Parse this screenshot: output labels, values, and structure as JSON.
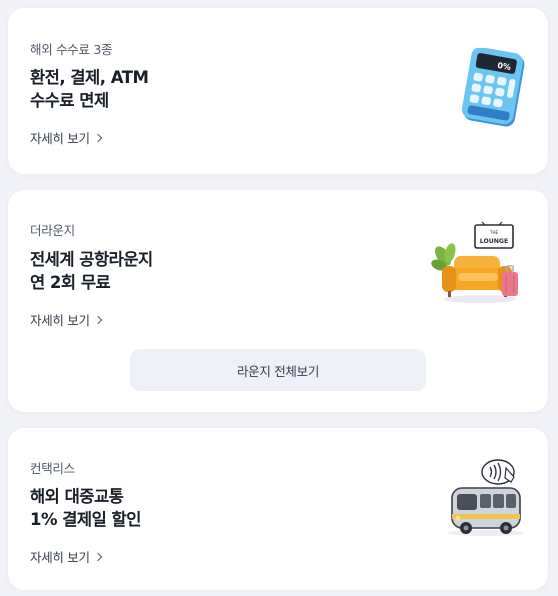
{
  "cards": [
    {
      "eyebrow": "해외 수수료 3종",
      "title_lines": [
        "환전, 결제, ATM",
        "수수료 면제"
      ],
      "link": "자세히 보기",
      "illustration": "calculator-icon",
      "calculator_display": "0%"
    },
    {
      "eyebrow": "더라운지",
      "title_lines": [
        "전세계 공항라운지",
        "연 2회 무료"
      ],
      "link": "자세히 보기",
      "illustration": "lounge-sofa-icon",
      "sign_small": "THE",
      "sign_text": "LOUNGE",
      "button": "라운지 전체보기"
    },
    {
      "eyebrow": "컨택리스",
      "title_lines": [
        "해외 대중교통",
        "1% 결제일 할인"
      ],
      "link": "자세히 보기",
      "illustration": "bus-contactless-icon"
    }
  ],
  "colors": {
    "background": "#f1f3f8",
    "card": "#ffffff",
    "title_text": "#191f28",
    "sub_text": "#4e5968",
    "cta_background": "#eef0f7",
    "calculator_blue": "#5ab8ec",
    "sofa_orange": "#f5a623",
    "bus_silver": "#cfd4dc"
  }
}
